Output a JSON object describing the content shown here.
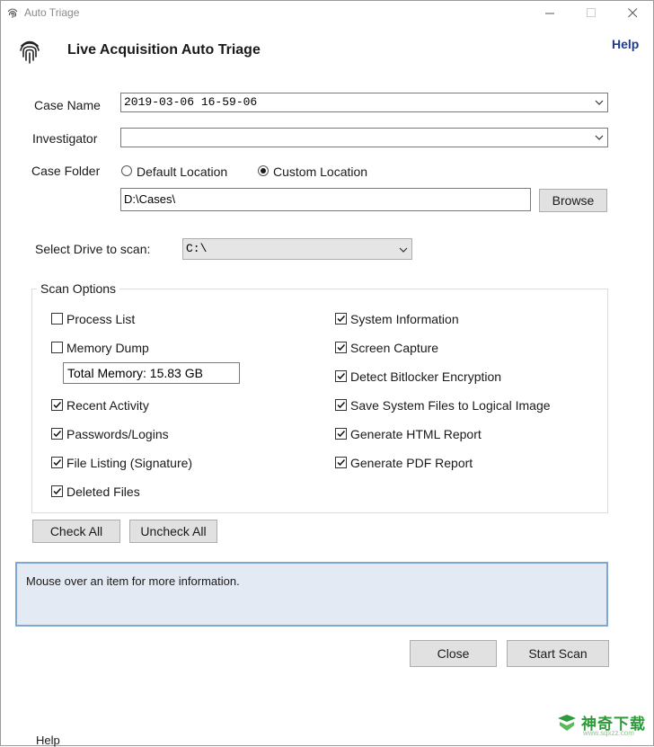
{
  "window": {
    "title": "Auto Triage",
    "controls": [
      "minimize-icon",
      "maximize-icon",
      "close-icon"
    ]
  },
  "header": {
    "title": "Live Acquisition Auto Triage",
    "help_label": "Help"
  },
  "form": {
    "case_name": {
      "label": "Case Name",
      "value": "2019-03-06 16-59-06"
    },
    "investigator": {
      "label": "Investigator",
      "value": ""
    },
    "case_folder": {
      "label": "Case Folder",
      "default_option": "Default Location",
      "custom_option": "Custom Location",
      "selected": "custom",
      "path": "D:\\Cases\\",
      "browse_label": "Browse"
    },
    "drive": {
      "label": "Select Drive to scan:",
      "value": "C:\\"
    }
  },
  "scan_options": {
    "title": "Scan Options",
    "left": [
      {
        "label": "Process List",
        "checked": false
      },
      {
        "label": "Memory Dump",
        "checked": false
      },
      {
        "label": "Recent Activity",
        "checked": true
      },
      {
        "label": "Passwords/Logins",
        "checked": true
      },
      {
        "label": "File Listing (Signature)",
        "checked": true
      },
      {
        "label": "Deleted Files",
        "checked": true
      }
    ],
    "memory_info": "Total Memory: 15.83 GB",
    "right": [
      {
        "label": "System Information",
        "checked": true
      },
      {
        "label": "Screen Capture",
        "checked": true
      },
      {
        "label": "Detect Bitlocker Encryption",
        "checked": true
      },
      {
        "label": "Save System Files to Logical Image",
        "checked": true
      },
      {
        "label": "Generate HTML Report",
        "checked": true
      },
      {
        "label": "Generate PDF Report",
        "checked": true
      }
    ]
  },
  "buttons": {
    "check_all": "Check All",
    "uncheck_all": "Uncheck All",
    "close": "Close",
    "start_scan": "Start Scan"
  },
  "info_text": "Mouse over an item for more information.",
  "watermark": {
    "text": "神奇下载",
    "sub": "www.sqxzz.com"
  },
  "background_text": "Help"
}
